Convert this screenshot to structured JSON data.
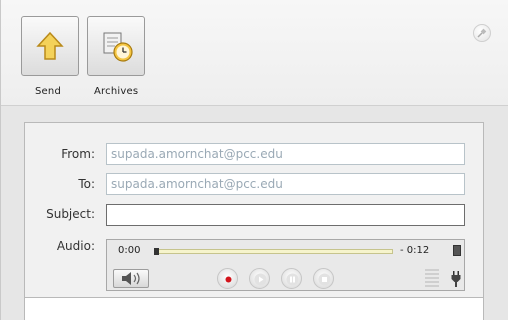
{
  "toolbar": {
    "send_label": "Send",
    "archives_label": "Archives"
  },
  "form": {
    "from_label": "From:",
    "from_value": "supada.amornchat@pcc.edu",
    "to_label": "To:",
    "to_value": "supada.amornchat@pcc.edu",
    "subject_label": "Subject:",
    "subject_value": "",
    "audio_label": "Audio:"
  },
  "audio": {
    "elapsed": "0:00",
    "remaining": "- 0:12",
    "progress": 0
  },
  "colors": {
    "record": "#d3141b",
    "field_text": "#9aa9b5",
    "track": "#f6f4cc"
  },
  "icons": {
    "send": "up-arrow-icon",
    "archives": "archive-clock-icon",
    "pin": "pin-icon",
    "speaker": "speaker-icon"
  }
}
